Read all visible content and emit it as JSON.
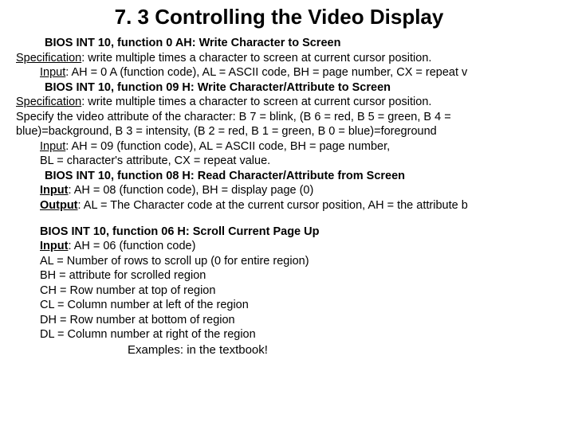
{
  "title": "7. 3 Controlling the Video Display",
  "sec1": {
    "head_prefix": "BIOS",
    "head_rest": " INT 10, function 0 AH: Write Character to Screen",
    "spec_label": "Specification",
    "spec_text": ": write multiple times a character to screen at current cursor position.",
    "input_label": "Input",
    "input_text": ": AH = 0 A (function code), AL = ASCII code, BH = page number, CX = repeat v"
  },
  "sec2": {
    "head_prefix": "BIOS",
    "head_rest": " INT 10, function 09 H: Write Character/Attribute to Screen",
    "spec_label": "Specification",
    "spec_line1": ": write multiple times a character to screen at current cursor position.",
    "spec_line2": "Specify the video attribute of the character: B 7 =  blink, (B 6 = red, B 5 = green, B 4 =",
    "spec_line3": "blue)=background, B 3 = intensity, (B 2 = red, B 1 = green, B 0 = blue)=foreground",
    "input_label": "Input",
    "input_line1": ": AH = 09 (function code), AL = ASCII code, BH = page number,",
    "input_line2": "BL = character's attribute, CX = repeat value."
  },
  "sec3": {
    "head_prefix": "BIOS",
    "head_rest": " INT 10, function 08 H: Read Character/Attribute from Screen",
    "input_label": "Input",
    "input_text": ": AH = 08 (function code),  BH = display page (0)",
    "output_label": "Output",
    "output_text": ": AL = The Character code at the current cursor position, AH = the attribute b"
  },
  "sec4": {
    "head_prefix": "BIOS",
    "head_rest": " INT 10, function 06 H: Scroll Current Page Up",
    "input_label": "Input",
    "input_text": ": AH = 06 (function code)",
    "l2": "AL = Number of rows to scroll up (0 for entire region)",
    "l3": "BH = attribute for scrolled region",
    "l4": "CH = Row number at top of region",
    "l5": "CL = Column number at left of the region",
    "l6": "DH = Row number at bottom of region",
    "l7": "DL = Column number at right of the region"
  },
  "examples": "Examples: in the textbook!"
}
